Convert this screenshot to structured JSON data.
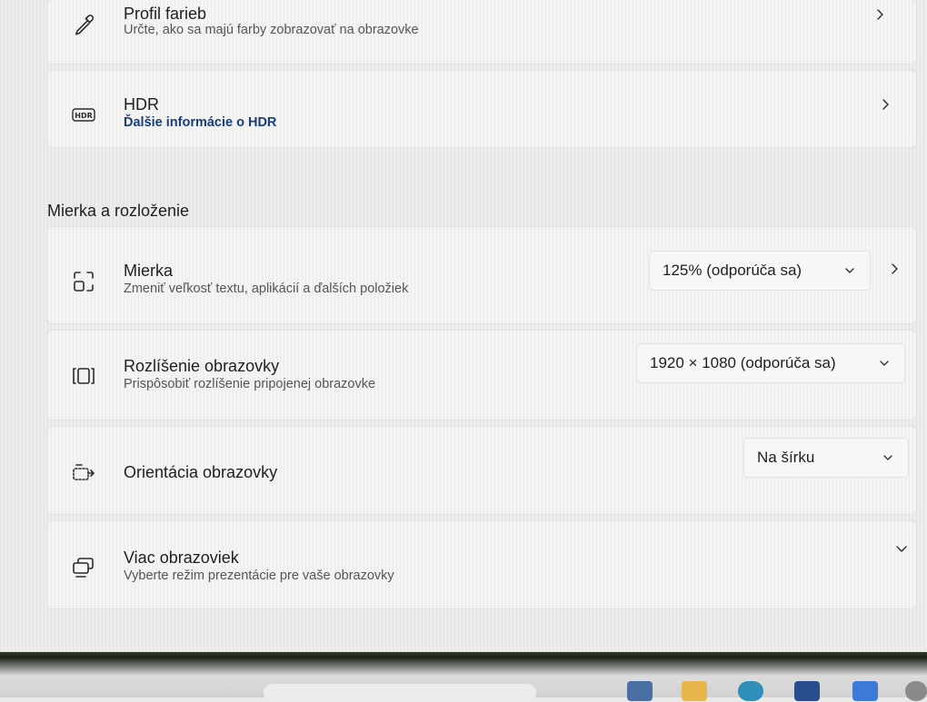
{
  "cards": {
    "color_profile": {
      "title": "Profil farieb",
      "subtitle": "Určte, ako sa majú farby zobrazovať na obrazovke"
    },
    "hdr": {
      "title": "HDR",
      "link": "Ďalšie informácie o HDR",
      "icon_text": "HDR"
    }
  },
  "section": {
    "title": "Mierka a rozloženie"
  },
  "scale": {
    "title": "Mierka",
    "subtitle": "Zmeniť veľkosť textu, aplikácií a ďalších položiek",
    "value": "125% (odporúča sa)"
  },
  "resolution": {
    "title": "Rozlíšenie obrazovky",
    "subtitle": "Prispôsobiť rozlíšenie pripojenej obrazovke",
    "value": "1920 × 1080 (odporúča sa)"
  },
  "orientation": {
    "title": "Orientácia obrazovky",
    "value": "Na šírku"
  },
  "multiple_displays": {
    "title": "Viac obrazoviek",
    "subtitle": "Vyberte režim prezentácie pre vaše obrazovky"
  },
  "icons": {
    "color_profile": "eyedropper-icon",
    "hdr": "hdr-icon",
    "scale": "scale-icon",
    "resolution": "resolution-icon",
    "orientation": "orientation-icon",
    "multiple_displays": "multiple-displays-icon"
  },
  "colors": {
    "background": "#ececea",
    "card": "#f4f4f2",
    "link": "#1a3d7c",
    "text": "#1f1f1f",
    "subtext": "#555555"
  }
}
